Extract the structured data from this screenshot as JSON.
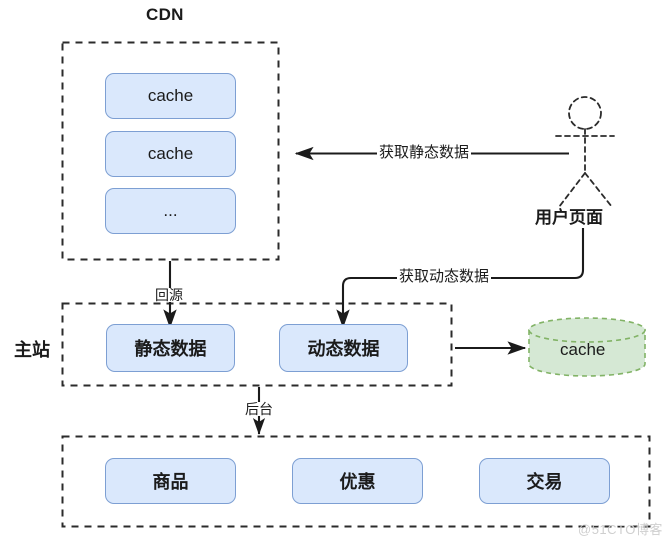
{
  "diagram": {
    "title_cdn": "CDN",
    "side_label_main": "主站",
    "cdn_nodes": [
      {
        "label": "cache"
      },
      {
        "label": "cache"
      },
      {
        "label": "..."
      }
    ],
    "main_nodes": [
      {
        "label": "静态数据"
      },
      {
        "label": "动态数据"
      }
    ],
    "cache_store": {
      "label": "cache"
    },
    "backend_nodes": [
      {
        "label": "商品"
      },
      {
        "label": "优惠"
      },
      {
        "label": "交易"
      }
    ],
    "actor": {
      "label": "用户页面"
    },
    "edges": [
      {
        "label": "获取静态数据"
      },
      {
        "label": "获取动态数据"
      },
      {
        "label": "回源"
      },
      {
        "label": "后台"
      }
    ],
    "watermark": "@51CTO博客",
    "colors": {
      "box_fill": "#dae8fc",
      "box_stroke": "#7d9fd3",
      "cyl_fill": "#d5e8d4",
      "cyl_stroke": "#82b366",
      "line": "#1b1b1b",
      "dashed_container": "#2b2b2b"
    }
  }
}
